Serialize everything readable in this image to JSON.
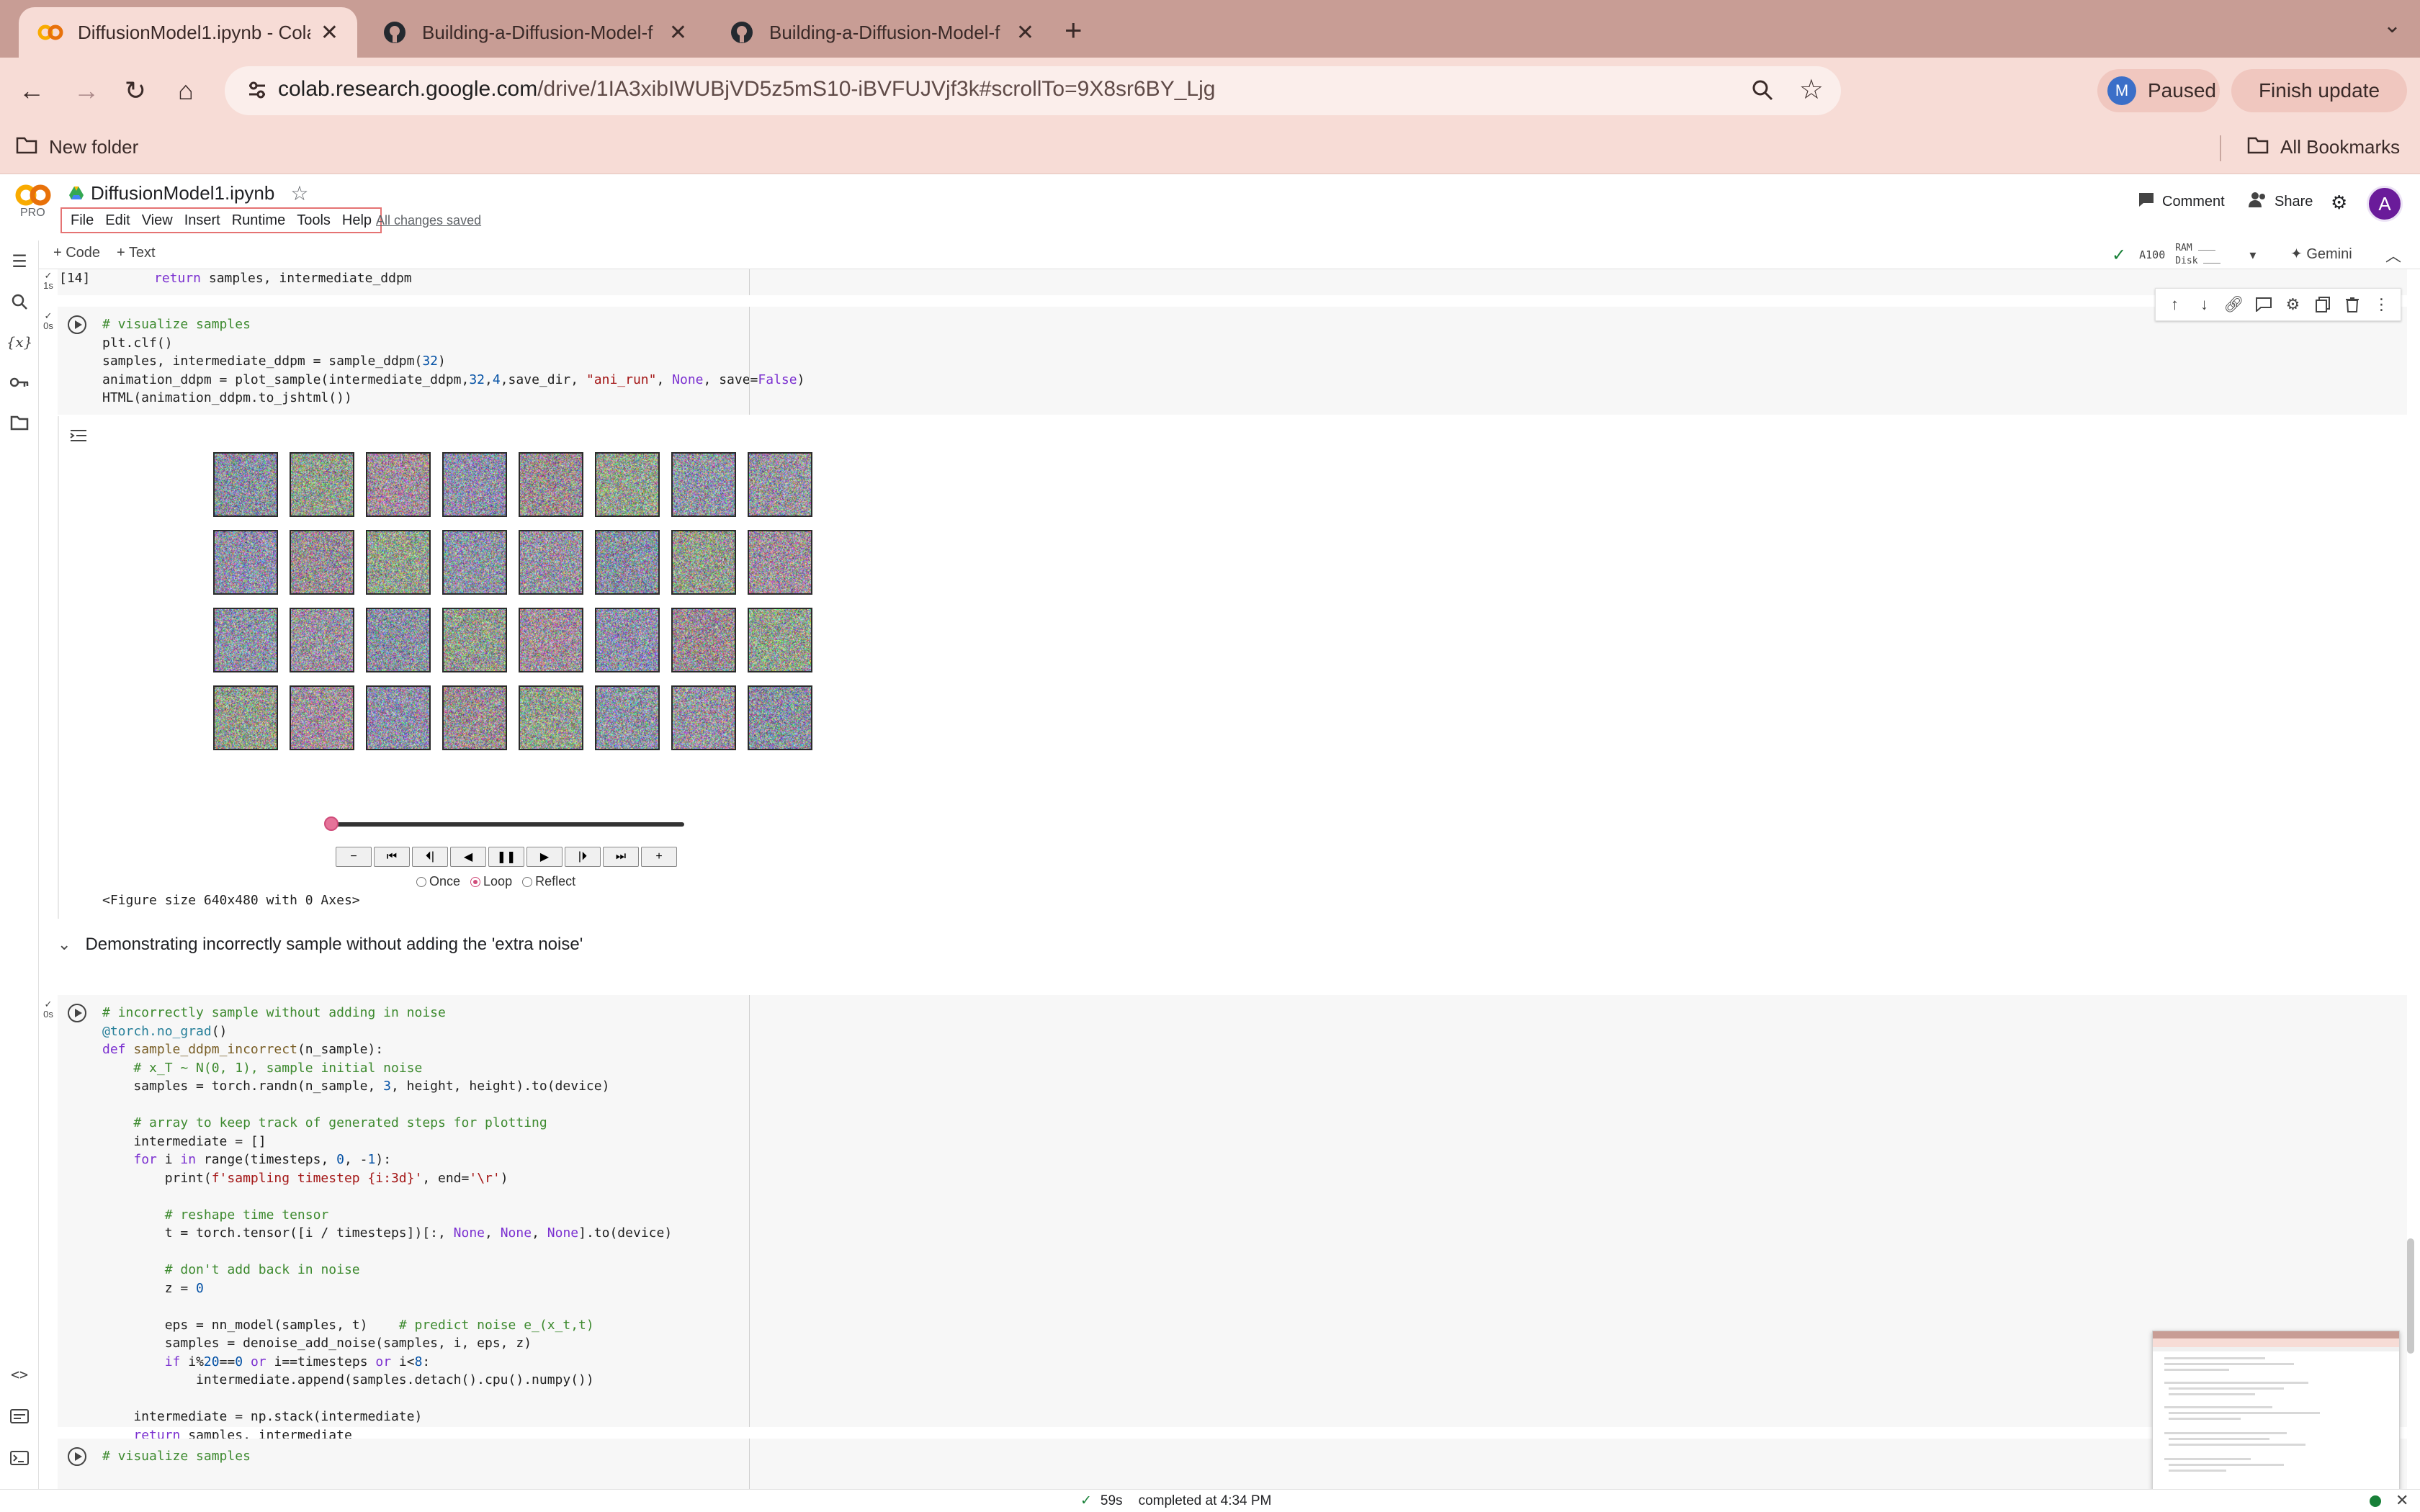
{
  "browser": {
    "tabs": [
      {
        "title": "DiffusionModel1.ipynb - Colab",
        "icon": "colab-icon",
        "active": true
      },
      {
        "title": "Building-a-Diffusion-Model-f",
        "icon": "github-icon",
        "active": false
      },
      {
        "title": "Building-a-Diffusion-Model-f",
        "icon": "github-icon",
        "active": false
      }
    ],
    "url_host": "colab.research.google.com",
    "url_path": "/drive/1IA3xibIWUBjVD5z5mS10-iBVFUJVjf3k#scrollTo=9X8sr6BY_Ljg",
    "profile_initial": "M",
    "profile_status": "Paused",
    "finish_update": "Finish update",
    "bookmarks": {
      "new_folder": "New folder",
      "all_bookmarks": "All Bookmarks"
    }
  },
  "colab": {
    "logo_pro": "PRO",
    "notebook_title": "DiffusionModel1.ipynb",
    "menu": [
      "File",
      "Edit",
      "View",
      "Insert",
      "Runtime",
      "Tools",
      "Help"
    ],
    "saved_status": "All changes saved",
    "comment": "Comment",
    "share": "Share",
    "avatar_initial": "A",
    "add_code": "+ Code",
    "add_text": "+ Text",
    "runtime": {
      "gpu": "A100",
      "ram": "RAM",
      "disk": "Disk"
    },
    "gemini": "Gemini"
  },
  "cells": {
    "prev_exec": "[14]",
    "prev_line": "return samples, intermediate_ddpm",
    "exec_time_prev": "1s",
    "exec_time_viz": "0s",
    "exec_time_incorrect": "0s",
    "fig_size": "<Figure size 640x480 with 0 Axes>",
    "section_title": "Demonstrating incorrectly sample without adding the 'extra noise'",
    "anim": {
      "once": "Once",
      "loop": "Loop",
      "reflect": "Reflect",
      "loop_mode": "Loop",
      "frame_progress": 0
    },
    "next_line": "# visualize samples"
  },
  "status": {
    "duration": "59s",
    "completed": "completed at 4:34 PM"
  },
  "colors": {
    "tab_bar": "#c89d95",
    "toolbar": "#f7dcd6",
    "accent_pink": "#d04c7a",
    "ok_green": "#188038"
  }
}
